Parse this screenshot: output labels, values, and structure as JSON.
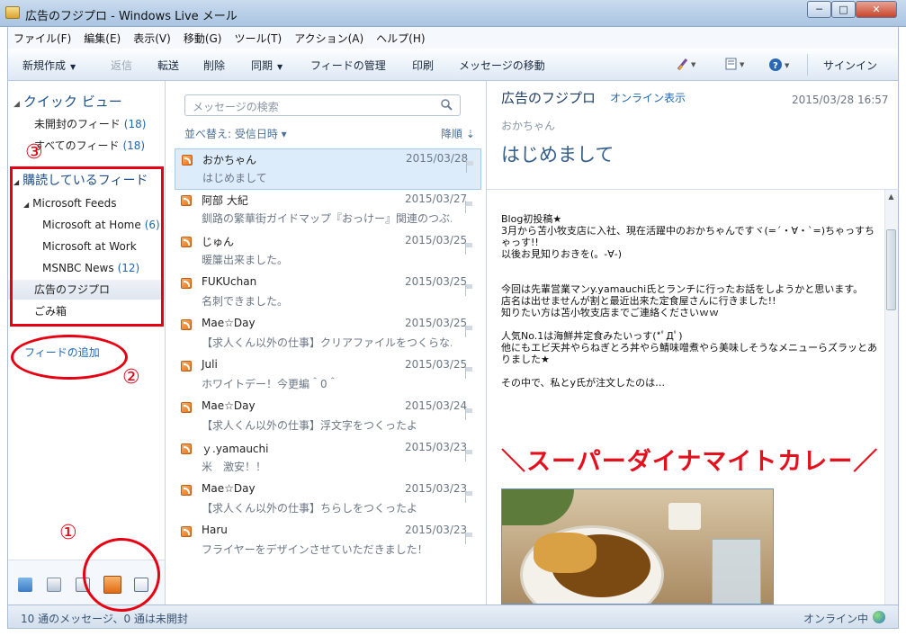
{
  "window": {
    "title": "広告のフジプロ - Windows Live メール",
    "buttons": {
      "minimize": "─",
      "maximize": "□",
      "close": "✕"
    }
  },
  "menu": [
    "ファイル(F)",
    "編集(E)",
    "表示(V)",
    "移動(G)",
    "ツール(T)",
    "アクション(A)",
    "ヘルプ(H)"
  ],
  "toolbar": {
    "new": "新規作成",
    "reply": "返信",
    "forward": "転送",
    "delete": "削除",
    "sync": "同期",
    "manage_feeds": "フィードの管理",
    "print": "印刷",
    "move": "メッセージの移動",
    "signin": "サインイン"
  },
  "nav": {
    "quick_view_header": "クイック ビュー",
    "unread_feeds": {
      "label": "未開封のフィード",
      "count": "(18)"
    },
    "all_feeds": {
      "label": "すべてのフィード",
      "count": "(18)"
    },
    "subscribed_header": "購読しているフィード",
    "ms_feeds": "Microsoft Feeds",
    "ms_home": {
      "label": "Microsoft at Home",
      "count": "(6)"
    },
    "ms_work": {
      "label": "Microsoft at Work",
      "count": ""
    },
    "msnbc": {
      "label": "MSNBC News",
      "count": "(12)"
    },
    "fujipro": {
      "label": "広告のフジプロ",
      "count": ""
    },
    "trash": {
      "label": "ごみ箱",
      "count": ""
    },
    "add_feed": "フィードの追加"
  },
  "list": {
    "search_placeholder": "メッセージの検索",
    "sort_label": "並べ替え: 受信日時 ▾",
    "sort_direction": "降順 ⇣",
    "messages": [
      {
        "from": "おかちゃん",
        "date": "2015/03/28",
        "subject": "はじめまして"
      },
      {
        "from": "阿部 大紀",
        "date": "2015/03/27",
        "subject": "釧路の繁華街ガイドマップ『おっけー』関連のつぶ..."
      },
      {
        "from": "じゅん",
        "date": "2015/03/25",
        "subject": "暖簾出来ました。"
      },
      {
        "from": "FUKUchan",
        "date": "2015/03/25",
        "subject": "名刺できました。"
      },
      {
        "from": "Mae☆Day",
        "date": "2015/03/25",
        "subject": "【求人くん以外の仕事】クリアファイルをつくらな..."
      },
      {
        "from": "Juli",
        "date": "2015/03/25",
        "subject": "ホワイトデー！今更編＾0＾"
      },
      {
        "from": "Mae☆Day",
        "date": "2015/03/24",
        "subject": "【求人くん以外の仕事】浮文字をつくったよ"
      },
      {
        "from": "ｙ.yamauchi",
        "date": "2015/03/23",
        "subject": "米　激安！！"
      },
      {
        "from": "Mae☆Day",
        "date": "2015/03/23",
        "subject": "【求人くん以外の仕事】ちらしをつくったよ"
      },
      {
        "from": "Haru",
        "date": "2015/03/23",
        "subject": "フライヤーをデザインさせていただきました！"
      }
    ]
  },
  "reading": {
    "feed_title": "広告のフジプロ",
    "online_view": "オンライン表示",
    "date": "2015/03/28 16:57",
    "author": "おかちゃん",
    "subject": "はじめまして",
    "body": [
      "Blog初投稿★",
      "3月から苫小牧支店に入社、現在活躍中のおかちゃんですヾ(=´・∀・`=)ちゃっすちゃっす!!",
      "以後お見知りおきを(。-∀-)",
      "今回は先輩営業マンy.yamauchi氏とランチに行ったお話をしようかと思います。",
      "店名は出せませんが割と最近出来た定食屋さんに行きました!!",
      "知りたい方は苫小牧支店までご連絡くださいｗｗ",
      "人気No.1は海鮮丼定食みたいっす(*ﾟДﾟ)",
      "他にもエビ天丼やらねぎとろ丼やら鯖味噌煮やら美味しそうなメニューらズラッとありました★",
      "その中で、私とy氏が注文したのは…"
    ],
    "headline": "＼スーパーダイナマイトカレー／"
  },
  "status": {
    "left": "10 通のメッセージ、0 通は未開封",
    "right": "オンライン中"
  },
  "annotations": [
    "①",
    "②",
    "③"
  ],
  "colors": {
    "annotation": "#e60012",
    "link": "#1f66b3",
    "headline": "#e5101d"
  }
}
